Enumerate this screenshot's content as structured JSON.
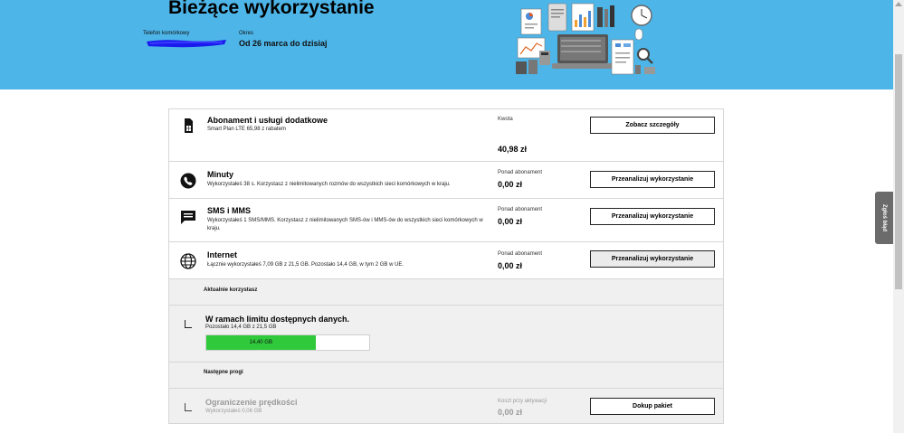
{
  "header": {
    "title": "Bieżące wykorzystanie",
    "phone_label": "Telefon komórkowy",
    "period_label": "Okres",
    "period_value": "Od 26 marca do dzisiaj",
    "background_color": "#4db5e8"
  },
  "feedback_tab": {
    "label": "Zgłoś błąd"
  },
  "rows": [
    {
      "icon": "sim-card-icon",
      "title": "Abonament i usługi dodatkowe",
      "description": "Smart Plan LTE 65,98 z rabatem",
      "amount_label": "Kwota",
      "amount_value": "40,98 zł",
      "button_label": "Zobacz szczegóły"
    },
    {
      "icon": "phone-icon",
      "title": "Minuty",
      "description": "Wykorzystałeś 38 s. Korzystasz z nielimitowanych rozmów do wszystkich sieci komórkowych w kraju.",
      "amount_label": "Ponad abonament",
      "amount_value": "0,00 zł",
      "button_label": "Przeanalizuj wykorzystanie"
    },
    {
      "icon": "message-icon",
      "title": "SMS i MMS",
      "description": "Wykorzystałeś 1 SMS/MMS. Korzystasz z nielimitowanych SMS-ów i MMS-ów do wszystkich sieci komórkowych w kraju.",
      "amount_label": "Ponad abonament",
      "amount_value": "0,00 zł",
      "button_label": "Przeanalizuj wykorzystanie"
    },
    {
      "icon": "globe-icon",
      "title": "Internet",
      "description": "Łącznie wykorzystałeś 7,09 GB z 21,5 GB. Pozostało 14,4 GB, w tym 2 GB w UE.",
      "amount_label": "Ponad abonament",
      "amount_value": "0,00 zł",
      "button_label": "Przeanalizuj wykorzystanie"
    }
  ],
  "internet_detail": {
    "current_label": "Aktualnie korzystasz",
    "limit_title": "W ramach limitu dostępnych danych.",
    "limit_sub": "Pozostało 14,4 GB z 21,5 GB",
    "bar_label": "14,40 GB",
    "bar_fraction": 0.6698,
    "bar_color": "#2fc93b",
    "next_label": "Następne progi",
    "throttle_title": "Ograniczenie prędkości",
    "throttle_sub": "Wykorzystałeś 0,06 GB",
    "throttle_cost_label": "Koszt przy aktywacji",
    "throttle_cost_value": "0,00 zł",
    "throttle_button": "Dokup pakiet"
  }
}
